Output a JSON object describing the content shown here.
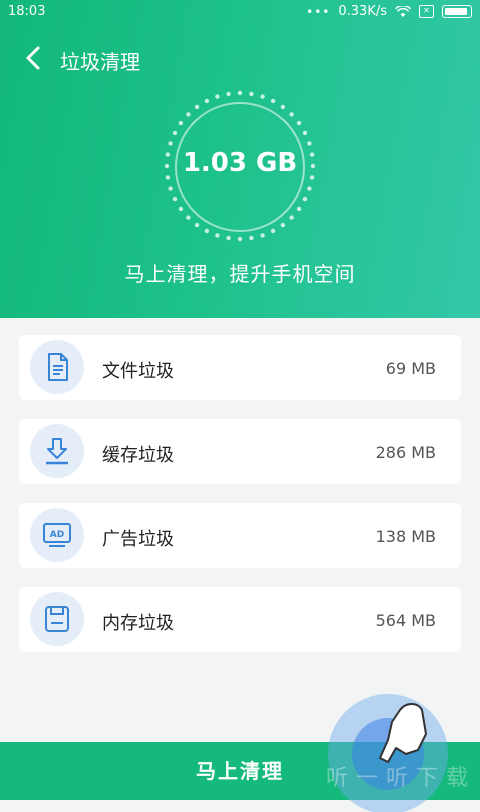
{
  "status": {
    "time": "18:03",
    "dots": "•••",
    "speed": "0.33K/s",
    "sim": "✕"
  },
  "title": "垃圾清理",
  "meter": {
    "value": "1.03 GB"
  },
  "slogan": "马上清理，提升手机空间",
  "items": [
    {
      "label": "文件垃圾",
      "size": "69 MB",
      "icon": "document-icon"
    },
    {
      "label": "缓存垃圾",
      "size": "286 MB",
      "icon": "download-icon"
    },
    {
      "label": "广告垃圾",
      "size": "138 MB",
      "icon": "ad-icon"
    },
    {
      "label": "内存垃圾",
      "size": "564 MB",
      "icon": "memory-card-icon"
    }
  ],
  "clean_button": "马上清理",
  "watermark": "听一听下载",
  "colors": {
    "primary": "#13b87a",
    "icon_blue": "#3a84d8",
    "icon_bg": "#e5eef8"
  }
}
